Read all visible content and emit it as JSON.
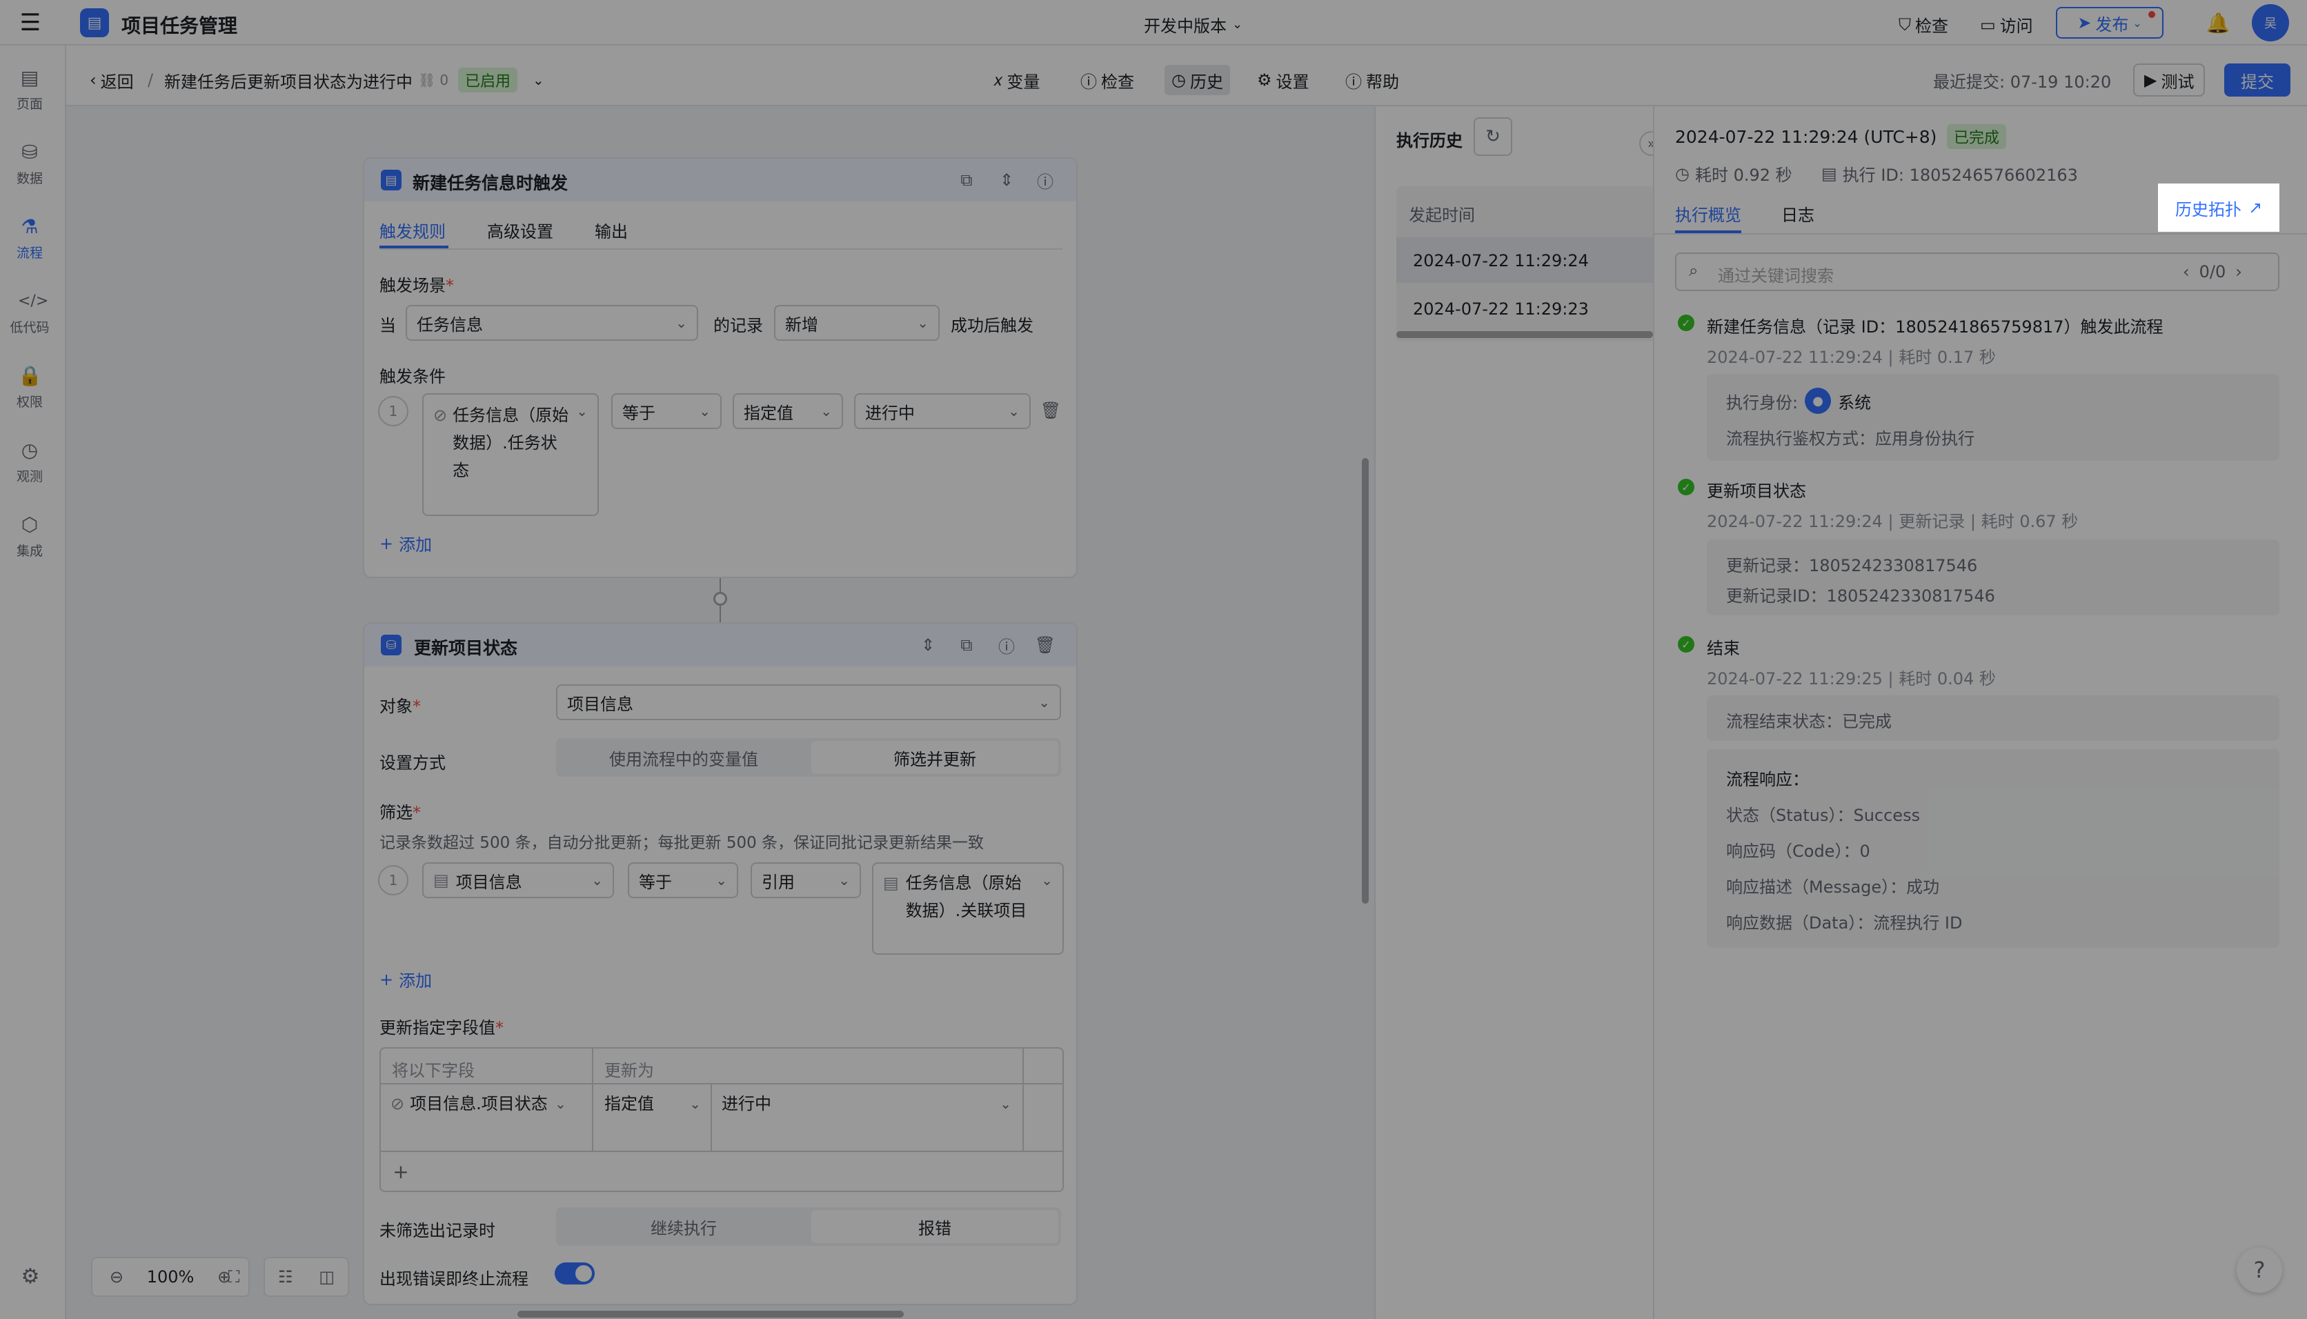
{
  "app": {
    "title": "项目任务管理",
    "version": "开发中版本",
    "check": "检查",
    "visit": "访问",
    "publish": "发布"
  },
  "sidebar": {
    "items": [
      {
        "label": "页面",
        "icon": "page-icon"
      },
      {
        "label": "数据",
        "icon": "database-icon"
      },
      {
        "label": "流程",
        "icon": "flow-icon"
      },
      {
        "label": "低代码",
        "icon": "code-icon"
      },
      {
        "label": "权限",
        "icon": "lock-icon"
      },
      {
        "label": "观测",
        "icon": "monitor-icon"
      },
      {
        "label": "集成",
        "icon": "integration-icon"
      }
    ]
  },
  "toolbar": {
    "back": "返回",
    "flow_name": "新建任务后更新项目状态为进行中",
    "link_count": "0",
    "status": "已启用",
    "variables": "变量",
    "check": "检查",
    "history": "历史",
    "settings": "设置",
    "help": "帮助",
    "last_submit": "最近提交: 07-19 10:20",
    "test": "测试",
    "submit": "提交"
  },
  "trigger_node": {
    "title": "新建任务信息时触发",
    "tabs": [
      "触发规则",
      "高级设置",
      "输出"
    ],
    "scene_label": "触发场景",
    "when": "当",
    "table": "任务信息",
    "of_record": "的记录",
    "action": "新增",
    "after": "成功后触发",
    "cond_label": "触发条件",
    "cond_index": "1",
    "field": "任务信息（原始数据）.任务状态",
    "op": "等于",
    "value_type": "指定值",
    "value": "进行中",
    "add": "添加"
  },
  "update_node": {
    "title": "更新项目状态",
    "object_label": "对象",
    "object_value": "项目信息",
    "mode_label": "设置方式",
    "mode_opt1": "使用流程中的变量值",
    "mode_opt2": "筛选并更新",
    "filter_label": "筛选",
    "filter_hint": "记录条数超过 500 条，自动分批更新；每批更新 500 条，保证同批记录更新结果一致",
    "f_index": "1",
    "f_field": "项目信息",
    "f_op": "等于",
    "f_type": "引用",
    "f_value": "任务信息（原始数据）.关联项目",
    "add": "添加",
    "set_label": "更新指定字段值",
    "col1": "将以下字段",
    "col2": "更新为",
    "row_field": "项目信息.项目状态",
    "row_type": "指定值",
    "row_value": "进行中",
    "nf_label": "未筛选出记录时",
    "nf_opt1": "继续执行",
    "nf_opt2": "报错",
    "err_label": "出现错误即终止流程"
  },
  "zoom": {
    "level": "100%"
  },
  "history": {
    "title": "执行历史",
    "col": "发起时间",
    "rows": [
      "2024-07-22 11:29:24",
      "2024-07-22 11:29:23"
    ]
  },
  "detail": {
    "time": "2024-07-22 11:29:24 (UTC+8)",
    "status": "已完成",
    "duration": "耗时 0.92 秒",
    "exec_id": "执行 ID: 1805246576602163",
    "tab1": "执行概览",
    "tab2": "日志",
    "history_topology": "历史拓扑",
    "search_placeholder": "通过关键词搜索",
    "search_count": "0/0",
    "steps": [
      {
        "title": "新建任务信息（记录 ID：1805241865759817）触发此流程",
        "meta": "2024-07-22 11:29:24 | 耗时 0.17 秒"
      },
      {
        "title": "更新项目状态",
        "meta": "2024-07-22 11:29:24 | 更新记录 | 耗时 0.67 秒"
      },
      {
        "title": "结束",
        "meta": "2024-07-22 11:29:25 | 耗时 0.04 秒"
      }
    ],
    "identity_label": "执行身份:",
    "identity": "系统",
    "auth": "流程执行鉴权方式：应用身份执行",
    "upd1": "更新记录：1805242330817546",
    "upd2": "更新记录ID：1805242330817546",
    "end_status": "流程结束状态：已完成",
    "resp_title": "流程响应：",
    "resp": [
      "状态（Status）：Success",
      "响应码（Code）：0",
      "响应描述（Message）：成功",
      "响应数据（Data）：流程执行 ID"
    ]
  },
  "colors": {
    "accent": "#3370ff",
    "success": "#34c724",
    "dim": "rgba(0,0,0,0.40)"
  }
}
